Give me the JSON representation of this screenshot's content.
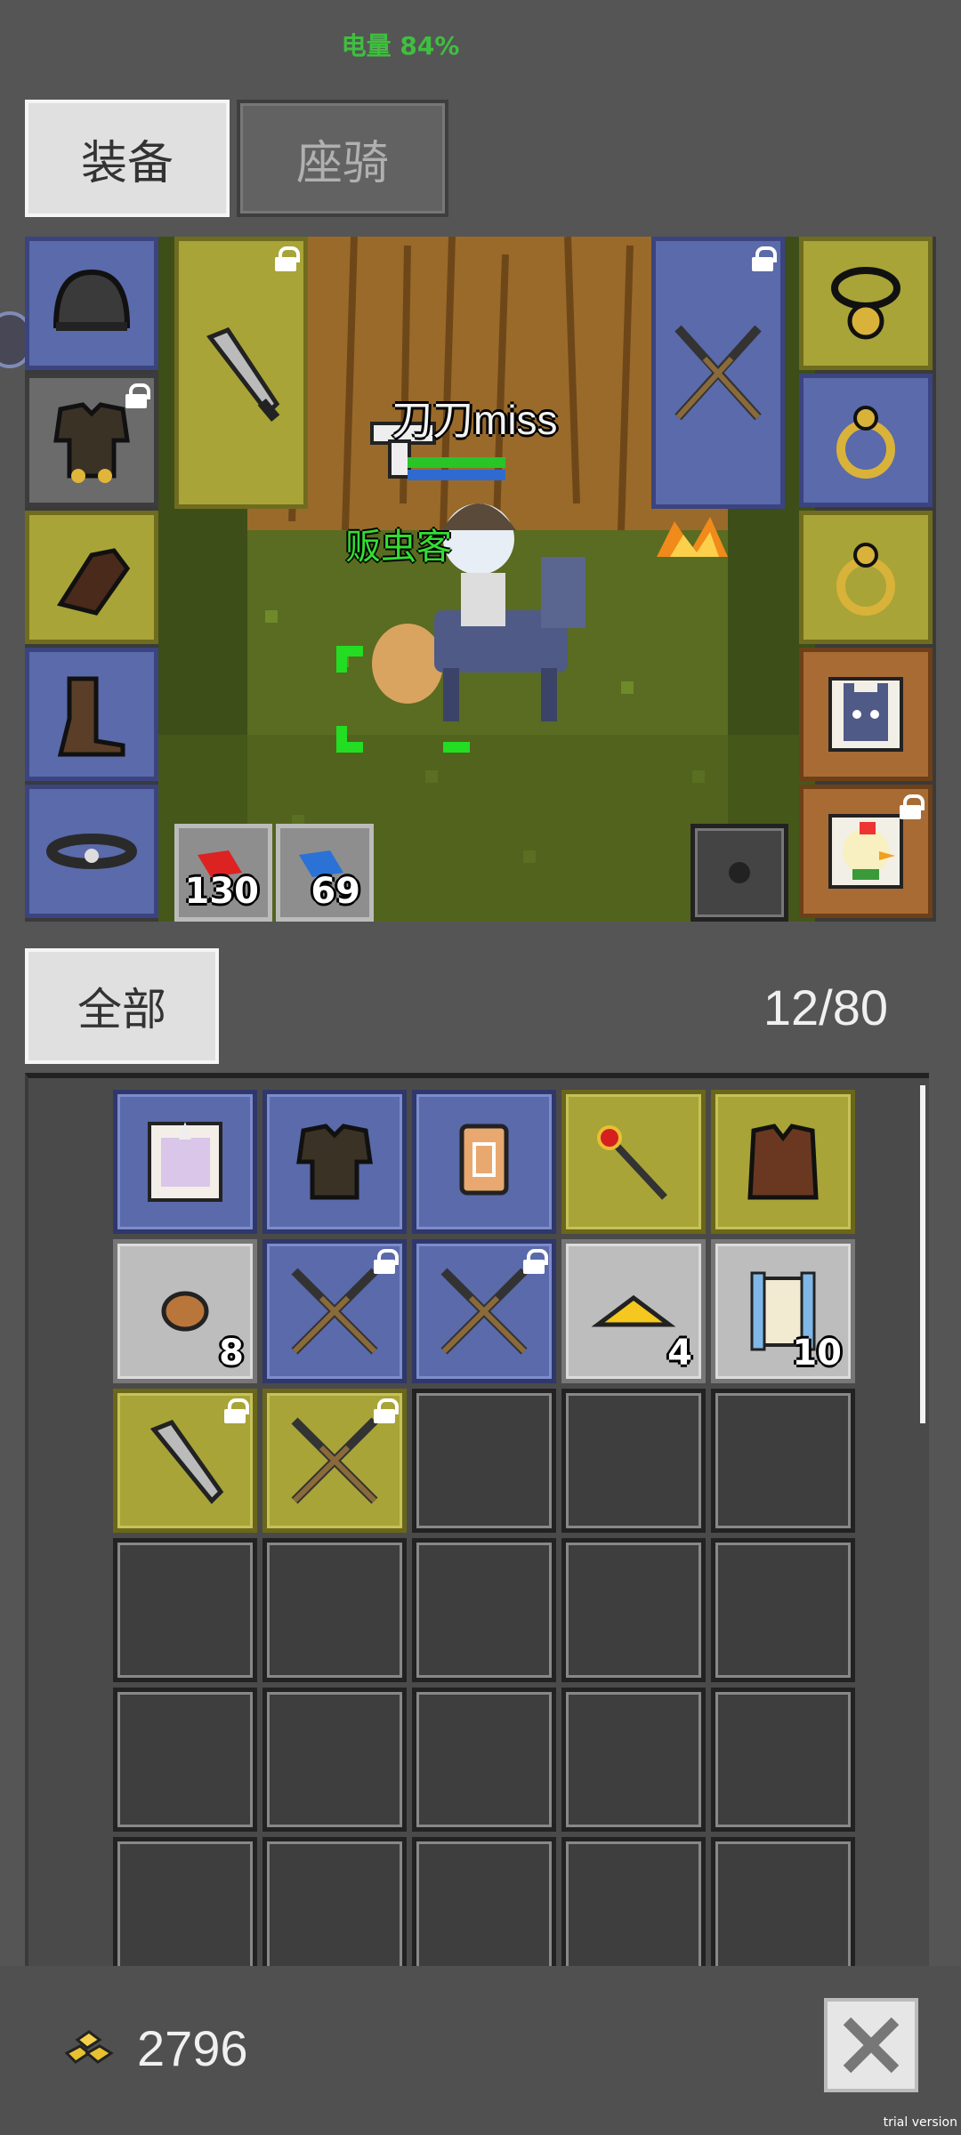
{
  "status": {
    "battery": "电量 84%"
  },
  "tabs": {
    "equip": "装备",
    "mount": "座骑"
  },
  "scene": {
    "player_name": "刀刀miss",
    "npc_name": "贩虫客",
    "hp_potions": "130",
    "mp_potions": "69"
  },
  "equipment": {
    "left_slots": [
      "helmet-icon",
      "armor-icon",
      "gloves-icon",
      "boots-icon",
      "belt-icon"
    ],
    "weapon_slot": "dagger-icon",
    "offhand_slot": "crossed-spears-icon",
    "right_slots": [
      "amulet-icon",
      "ring-icon",
      "ring-icon",
      "donkey-mount-icon",
      "chicken-pet-icon"
    ]
  },
  "inventory": {
    "filter_label": "全部",
    "capacity": "12/80",
    "items": [
      {
        "icon": "unicorn-card-icon",
        "rarity": "blue",
        "count": ""
      },
      {
        "icon": "chest-armor-icon",
        "rarity": "blue",
        "count": ""
      },
      {
        "icon": "scroll-card-icon",
        "rarity": "blue",
        "count": ""
      },
      {
        "icon": "ruby-staff-icon",
        "rarity": "yellow",
        "count": ""
      },
      {
        "icon": "leather-vest-icon",
        "rarity": "yellow",
        "count": ""
      },
      {
        "icon": "meat-icon",
        "rarity": "light",
        "count": "8"
      },
      {
        "icon": "crossed-spears-icon",
        "rarity": "blue",
        "count": "",
        "locked": true
      },
      {
        "icon": "crossed-spears-icon",
        "rarity": "blue",
        "count": "",
        "locked": true
      },
      {
        "icon": "cheese-icon",
        "rarity": "light",
        "count": "4"
      },
      {
        "icon": "scroll-icon",
        "rarity": "light",
        "count": "10"
      },
      {
        "icon": "dagger-icon",
        "rarity": "yellow",
        "count": "",
        "locked": true
      },
      {
        "icon": "crossed-spears-icon",
        "rarity": "yellow",
        "count": "",
        "locked": true
      }
    ]
  },
  "footer": {
    "gold": "2796"
  },
  "watermark": "trial version"
}
